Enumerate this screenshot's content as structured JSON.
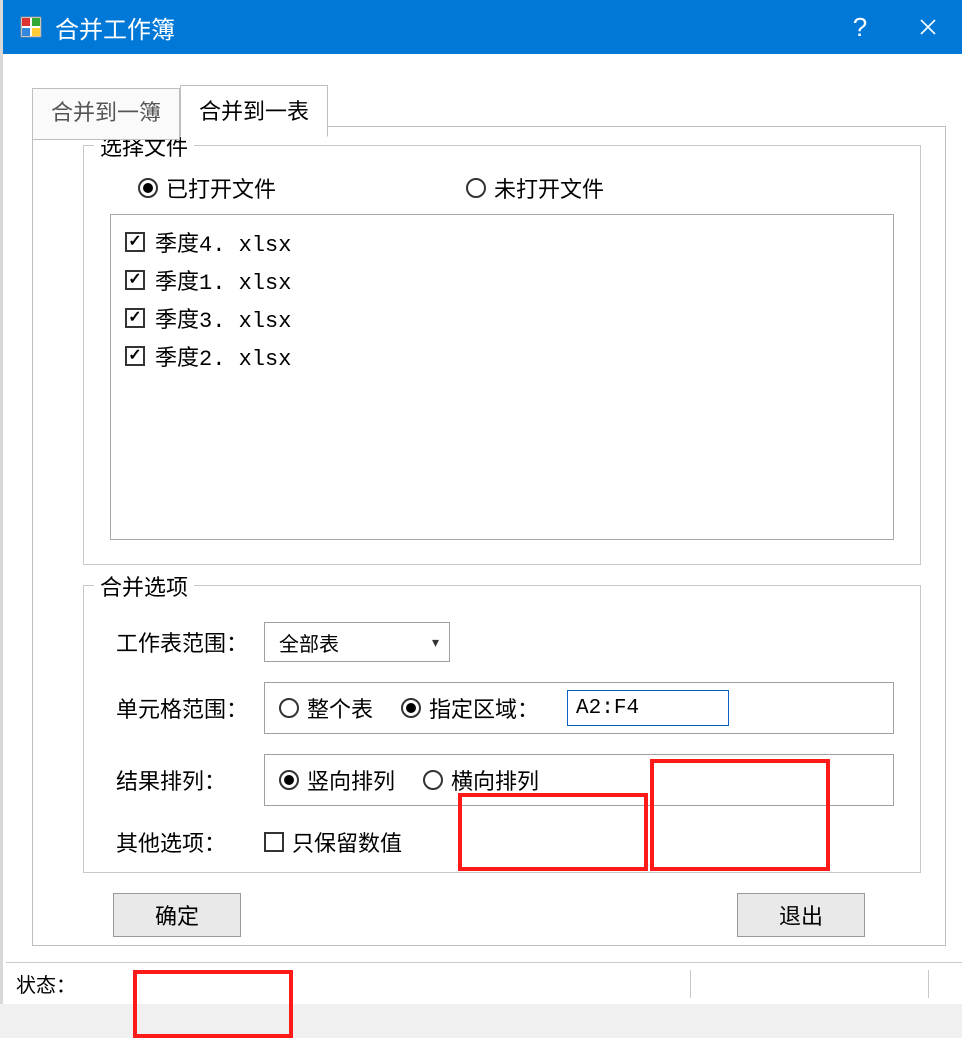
{
  "window": {
    "title": "合并工作簿"
  },
  "tabs": {
    "tab1": "合并到一簿",
    "tab2": "合并到一表"
  },
  "file_group": {
    "legend": "选择文件",
    "radio_opened": "已打开文件",
    "radio_unopened": "未打开文件",
    "files": [
      "季度4. xlsx",
      "季度1. xlsx",
      "季度3. xlsx",
      "季度2. xlsx"
    ]
  },
  "merge_group": {
    "legend": "合并选项",
    "sheet_range_label": "工作表范围：",
    "sheet_range_value": "全部表",
    "cell_range_label": "单元格范围：",
    "cell_whole_sheet": "整个表",
    "cell_specified": "指定区域：",
    "cell_range_value": "A2:F4",
    "result_layout_label": "结果排列：",
    "result_vertical": "竖向排列",
    "result_horizontal": "横向排列",
    "other_label": "其他选项：",
    "keep_values_only": "只保留数值"
  },
  "buttons": {
    "ok": "确定",
    "exit": "退出"
  },
  "status": {
    "label": "状态："
  }
}
